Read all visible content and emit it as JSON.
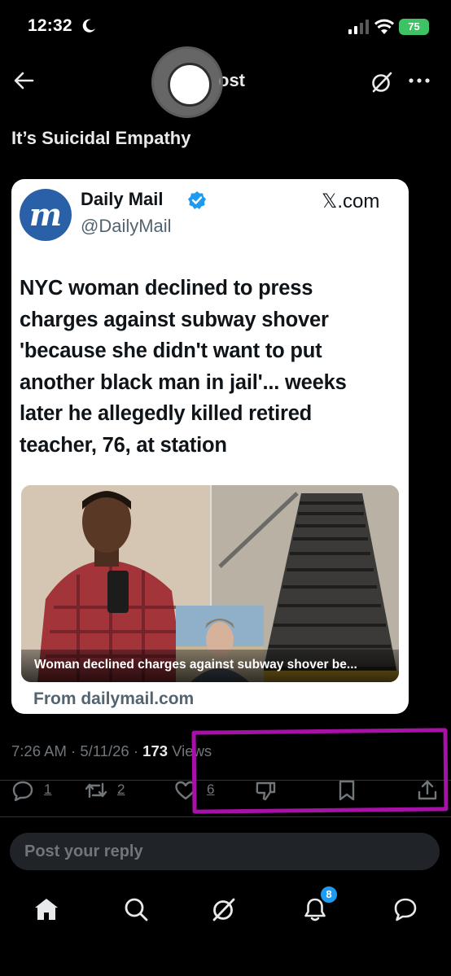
{
  "status_bar": {
    "time": "12:32",
    "battery": "75",
    "icons": [
      "moon-icon",
      "cellular-signal-icon",
      "wifi-icon",
      "battery-charging-icon"
    ]
  },
  "header": {
    "title_visible": "ost",
    "icons": [
      "back-arrow-icon",
      "grok-icon",
      "more-icon"
    ]
  },
  "post": {
    "text": "It’s Suicidal Empathy"
  },
  "card": {
    "author_name": "Daily Mail",
    "handle": "@DailyMail",
    "avatar_letter": "m",
    "source": "𝕏.com",
    "headline": "NYC woman declined to press charges against subway shover 'because she didn't want to put another black man in jail'... weeks later he allegedly killed retired teacher, 76, at station",
    "media_caption": "Woman declined charges against subway shover be...",
    "from": "From dailymail.com"
  },
  "meta": {
    "time": "7:26 AM",
    "separator": " · ",
    "date": "5/11/26",
    "views_count": "173",
    "views_label": " Views"
  },
  "actions": {
    "replies": "1",
    "reposts": "2",
    "likes": "6"
  },
  "reply": {
    "placeholder": "Post your reply"
  },
  "nav": {
    "notifications_badge": "8",
    "items": [
      "home-icon",
      "search-icon",
      "grok-icon",
      "notifications-icon",
      "messages-icon"
    ]
  },
  "colors": {
    "background": "#000000",
    "accent": "#1d9bf0",
    "highlight": "#a711a7",
    "battery": "#3ec364"
  }
}
